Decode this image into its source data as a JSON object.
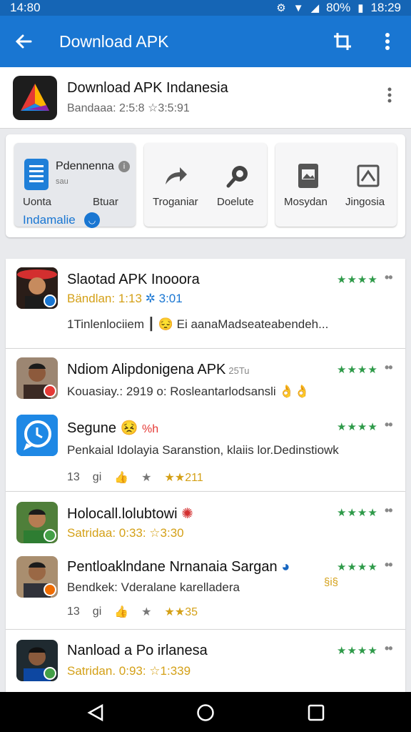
{
  "status_bar": {
    "time_left": "14:80",
    "battery": "80%",
    "time_right": "18:29"
  },
  "app_bar": {
    "title": "Download APK"
  },
  "header": {
    "title": "Download APK Indanesia",
    "subtitle": "Bandaaa: 2:5:8 ☆3:5:91"
  },
  "action_tiles": {
    "tile_a": {
      "name": "Pdennenna",
      "small": "sau",
      "left_label": "Uonta",
      "right_label": "Btuar",
      "link": "Indamalie"
    },
    "tile_b": {
      "left_label": "Troganiar",
      "right_label": "Doelute"
    },
    "tile_c": {
      "left_label": "Mosydan",
      "right_label": "Jingosia"
    }
  },
  "apps": [
    {
      "title": "Slaotad APK Inooora",
      "subtitle_prefix": "Bändlan: 1:13",
      "subtitle_rating": "3:01",
      "desc_left": "1Tinlenlociiem",
      "desc_right": "Ei aanaMadseateabendeh...",
      "stars": "★★★★",
      "more": "••"
    },
    {
      "title": "Ndiom Alipdonigena APK",
      "title_note": "25Tu",
      "subtitle": "Kouasiay.: 2919 o: Rosleantarlodsansli",
      "stars": "★★★★",
      "more": "••"
    },
    {
      "title": "Segune",
      "title_note": "%h",
      "desc": "Penkaial Idolayia Saranstion, klaiis lor.Dedinstiowk",
      "meta_count": "13",
      "meta_gi": "gi",
      "meta_rating": "★★211",
      "stars": "★★★★",
      "more": "••"
    },
    {
      "title": "Holocall.lolubtowi",
      "subtitle": "Satridaa: 0:33: ☆3:30",
      "stars": "★★★★",
      "more": "••"
    },
    {
      "title": "Pentloaklndane Nrnanaia Sargan",
      "subtitle": "Bendkek: Vderalane karelladera",
      "side_note": "§i§",
      "meta_count": "13",
      "meta_gi": "gi",
      "meta_rating": "★★35",
      "stars": "★★★★",
      "more": "••"
    },
    {
      "title": "Nanload a Po irlanesa",
      "subtitle": "Satridan. 0:93: ☆1:339",
      "stars": "★★★★",
      "more": "••"
    }
  ],
  "colors": {
    "app_bar": "#1976d2",
    "status_bar": "#1565b5",
    "stars": "#2e9a49",
    "accent": "#1976d2"
  }
}
